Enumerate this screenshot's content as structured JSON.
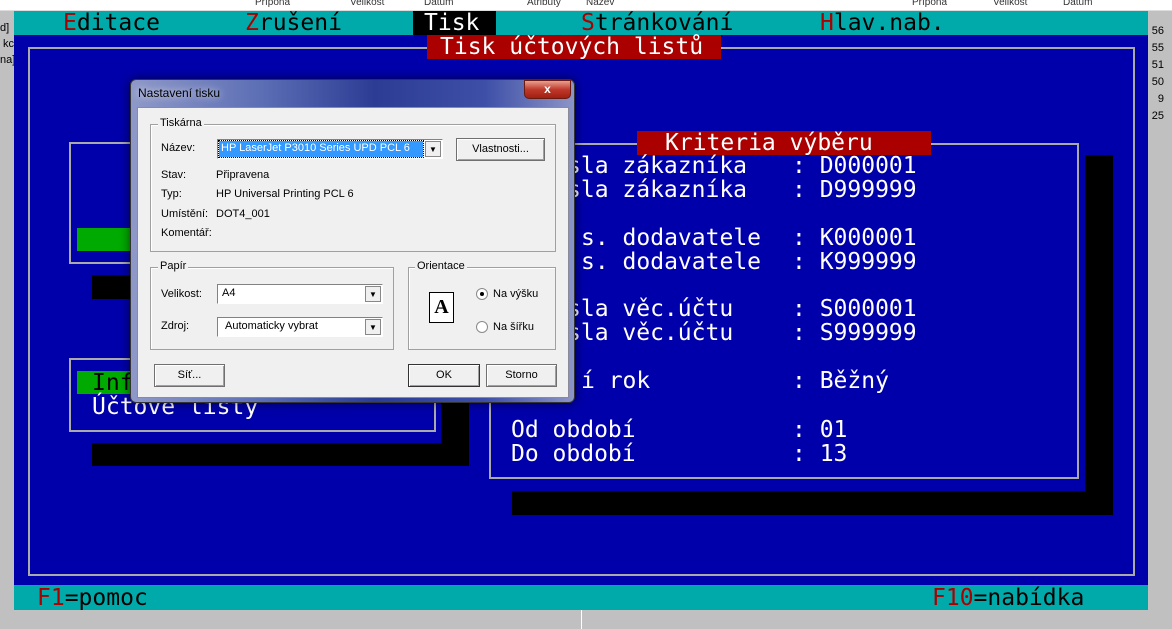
{
  "background_app": {
    "left_headers": [
      "Přípona",
      "Velikost",
      "Datum",
      "Atributy"
    ],
    "right_headers": [
      "Název",
      "Přípona",
      "Velikost",
      "Datum"
    ],
    "left_edge": [
      "d]",
      "kc",
      "na]"
    ],
    "right_edge": [
      "56",
      "55",
      "51",
      "50",
      "9",
      "25"
    ]
  },
  "menu": [
    {
      "hotkey": "E",
      "rest": "ditace"
    },
    {
      "hotkey": "Z",
      "rest": "rušení"
    },
    {
      "label": "Tisk"
    },
    {
      "hotkey": "S",
      "rest": "tránkování"
    },
    {
      "hotkey": "H",
      "rest": "lav.nab."
    }
  ],
  "screen_title": "Tisk účtových listů",
  "left_panel": {
    "item1": "Inf",
    "item2": "Účtové listy"
  },
  "criteria": {
    "title": "Kriteria výběru",
    "rows": [
      {
        "label": "sla zákazníka",
        "value": ": D000001"
      },
      {
        "label": "sla zákazníka",
        "value": ": D999999"
      },
      {
        "label": "s. dodavatele",
        "value": ": K000001"
      },
      {
        "label": "s. dodavatele",
        "value": ": K999999"
      },
      {
        "label": "sla věc.účtu",
        "value": ": S000001"
      },
      {
        "label": "sla věc.účtu",
        "value": ": S999999"
      },
      {
        "label": "í rok",
        "value": ": Běžný"
      },
      {
        "label": "Od období",
        "value": ": 01"
      },
      {
        "label": "Do období",
        "value": ": 13"
      }
    ]
  },
  "footer": {
    "f1_key": "F1",
    "f1_text": "=pomoc",
    "f10_key": "F10",
    "f10_text": "=nabídka"
  },
  "dialog": {
    "title": "Nastavení tisku",
    "close": "x",
    "printer_group": "Tiskárna",
    "name_label": "Název:",
    "name_value": "HP LaserJet P3010 Series UPD PCL 6",
    "properties_button": "Vlastnosti...",
    "status_label": "Stav:",
    "status_value": "Připravena",
    "type_label": "Typ:",
    "type_value": "HP Universal Printing PCL 6",
    "location_label": "Umístění:",
    "location_value": "DOT4_001",
    "comment_label": "Komentář:",
    "paper_group": "Papír",
    "size_label": "Velikost:",
    "size_value": "A4",
    "source_label": "Zdroj:",
    "source_value": "Automaticky vybrat",
    "orientation_group": "Orientace",
    "orientation_icon_letter": "A",
    "portrait": "Na výšku",
    "landscape": "Na šířku",
    "network_button": "Síť...",
    "ok_button": "OK",
    "cancel_button": "Storno"
  }
}
